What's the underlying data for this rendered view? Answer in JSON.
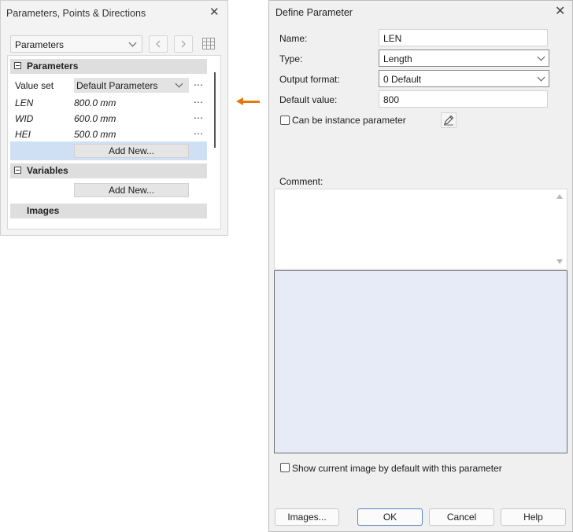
{
  "left_panel": {
    "title": "Parameters, Points & Directions",
    "dropdown_value": "Parameters",
    "parameters_section": {
      "header": "Parameters",
      "value_set_label": "Value set",
      "value_set_value": "Default Parameters",
      "rows": [
        {
          "name": "LEN",
          "value": "800.0 mm"
        },
        {
          "name": "WID",
          "value": "600.0 mm"
        },
        {
          "name": "HEI",
          "value": "500.0 mm"
        }
      ],
      "add_new": "Add New..."
    },
    "variables_section": {
      "header": "Variables",
      "add_new": "Add New..."
    },
    "images_section": {
      "header": "Images"
    },
    "more_glyph": "⋯",
    "close_glyph": "✕",
    "icons": [
      "close-icon",
      "chevron-left-icon",
      "chevron-right-icon",
      "grid-icon",
      "collapse-icon"
    ]
  },
  "dialog": {
    "title": "Define Parameter",
    "close_glyph": "✕",
    "name_label": "Name:",
    "name_value": "LEN",
    "type_label": "Type:",
    "type_value": "Length",
    "output_format_label": "Output format:",
    "output_format_value": "0 Default",
    "default_value_label": "Default value:",
    "default_value": "800",
    "instance_checkbox_label": "Can be instance parameter",
    "instance_checked": false,
    "comment_label": "Comment:",
    "comment_value": "",
    "show_image_label": "Show current image by default with this parameter",
    "show_image_checked": false,
    "buttons": {
      "images": "Images...",
      "ok": "OK",
      "cancel": "Cancel",
      "help": "Help"
    }
  },
  "colors": {
    "accent_arrow": "#e07a10",
    "selected_row": "#cfe0f5",
    "image_area": "#e6ebf7"
  }
}
